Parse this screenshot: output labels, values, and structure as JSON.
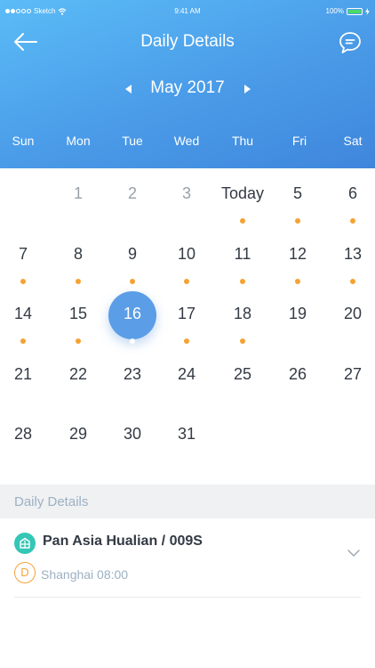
{
  "status_bar": {
    "carrier": "Sketch",
    "time": "9:41 AM",
    "battery": "100%"
  },
  "header": {
    "title": "Daily Details",
    "month": "May 2017",
    "weekdays": [
      "Sun",
      "Mon",
      "Tue",
      "Wed",
      "Thu",
      "Fri",
      "Sat"
    ]
  },
  "calendar": {
    "rows": [
      [
        {
          "label": "",
          "event": false,
          "muted": false,
          "selected": false
        },
        {
          "label": "1",
          "event": false,
          "muted": true,
          "selected": false
        },
        {
          "label": "2",
          "event": false,
          "muted": true,
          "selected": false
        },
        {
          "label": "3",
          "event": false,
          "muted": true,
          "selected": false
        },
        {
          "label": "Today",
          "event": true,
          "muted": false,
          "selected": false
        },
        {
          "label": "5",
          "event": true,
          "muted": false,
          "selected": false
        },
        {
          "label": "6",
          "event": true,
          "muted": false,
          "selected": false
        }
      ],
      [
        {
          "label": "7",
          "event": true,
          "muted": false,
          "selected": false
        },
        {
          "label": "8",
          "event": true,
          "muted": false,
          "selected": false
        },
        {
          "label": "9",
          "event": true,
          "muted": false,
          "selected": false
        },
        {
          "label": "10",
          "event": true,
          "muted": false,
          "selected": false
        },
        {
          "label": "11",
          "event": true,
          "muted": false,
          "selected": false
        },
        {
          "label": "12",
          "event": true,
          "muted": false,
          "selected": false
        },
        {
          "label": "13",
          "event": true,
          "muted": false,
          "selected": false
        }
      ],
      [
        {
          "label": "14",
          "event": true,
          "muted": false,
          "selected": false
        },
        {
          "label": "15",
          "event": true,
          "muted": false,
          "selected": false
        },
        {
          "label": "16",
          "event": true,
          "muted": false,
          "selected": true
        },
        {
          "label": "17",
          "event": true,
          "muted": false,
          "selected": false
        },
        {
          "label": "18",
          "event": true,
          "muted": false,
          "selected": false
        },
        {
          "label": "19",
          "event": false,
          "muted": false,
          "selected": false
        },
        {
          "label": "20",
          "event": false,
          "muted": false,
          "selected": false
        }
      ],
      [
        {
          "label": "21",
          "event": false,
          "muted": false,
          "selected": false
        },
        {
          "label": "22",
          "event": false,
          "muted": false,
          "selected": false
        },
        {
          "label": "23",
          "event": false,
          "muted": false,
          "selected": false
        },
        {
          "label": "24",
          "event": false,
          "muted": false,
          "selected": false
        },
        {
          "label": "25",
          "event": false,
          "muted": false,
          "selected": false
        },
        {
          "label": "26",
          "event": false,
          "muted": false,
          "selected": false
        },
        {
          "label": "27",
          "event": false,
          "muted": false,
          "selected": false
        }
      ],
      [
        {
          "label": "28",
          "event": false,
          "muted": false,
          "selected": false
        },
        {
          "label": "29",
          "event": false,
          "muted": false,
          "selected": false
        },
        {
          "label": "30",
          "event": false,
          "muted": false,
          "selected": false
        },
        {
          "label": "31",
          "event": false,
          "muted": false,
          "selected": false
        },
        {
          "label": "",
          "event": false,
          "muted": false,
          "selected": false
        },
        {
          "label": "",
          "event": false,
          "muted": false,
          "selected": false
        },
        {
          "label": "",
          "event": false,
          "muted": false,
          "selected": false
        }
      ]
    ]
  },
  "section": {
    "title": "Daily Details"
  },
  "detail": {
    "title": "Pan Asia Hualian / 009S",
    "badge": "D",
    "subtitle": "Shanghai 08:00",
    "icons": {
      "ship": "ship-icon",
      "expand": "chevron-down-icon"
    }
  },
  "colors": {
    "header_start": "#5bbcf7",
    "header_end": "#3f86dc",
    "selected": "#5b9de6",
    "event_dot": "#f5a233",
    "ship_icon": "#35c6b5",
    "badge": "#f3a33b",
    "section_bg": "#f0f1f3"
  }
}
